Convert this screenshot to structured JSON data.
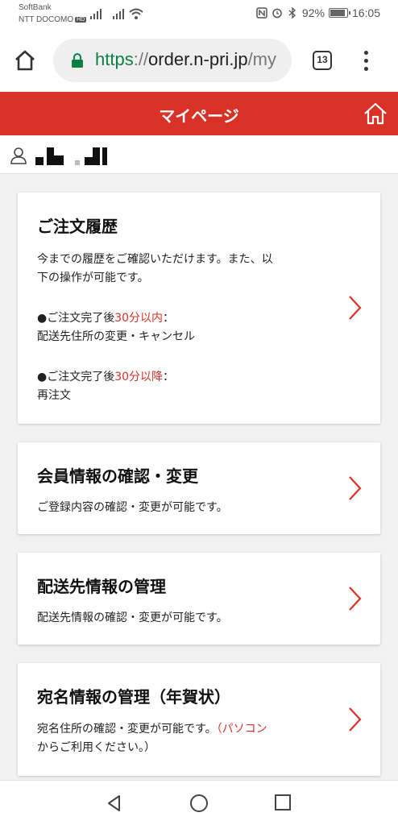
{
  "status": {
    "carrier1": "SoftBank",
    "carrier2": "NTT DOCOMO",
    "carrier2_badge": "HD",
    "battery": "92%",
    "time": "16:05"
  },
  "browser": {
    "url_scheme": "https",
    "url_sep": "://",
    "url_host": "order.n-pri.jp",
    "url_path": "/my",
    "tab_count": "13"
  },
  "header": {
    "title": "マイページ"
  },
  "cards": [
    {
      "title": "ご注文履歴",
      "desc_line1": "今までの履歴をご確認いただけます。また、以",
      "desc_line2": "下の操作が可能です。",
      "item1_prefix": "●ご注文完了後",
      "item1_highlight": "30分以内",
      "item1_suffix": "：",
      "item1_detail": "配送先住所の変更・キャンセル",
      "item2_prefix": "●ご注文完了後",
      "item2_highlight": "30分以降",
      "item2_suffix": "：",
      "item2_detail": "再注文"
    },
    {
      "title": "会員情報の確認・変更",
      "desc": "ご登録内容の確認・変更が可能です。"
    },
    {
      "title": "配送先情報の管理",
      "desc": "配送先情報の確認・変更が可能です。"
    },
    {
      "title": "宛名情報の管理（年賀状）",
      "desc_line1_normal": "宛名住所の確認・変更が可能です。",
      "desc_line1_red": "（パソコン",
      "desc_line2_red": "からご利用ください。）"
    }
  ],
  "colors": {
    "accent": "#d83227",
    "secure": "#0b8043"
  },
  "icons": {
    "header_home": "home-icon",
    "user": "user-icon",
    "chevron": "chevron-right-icon"
  }
}
